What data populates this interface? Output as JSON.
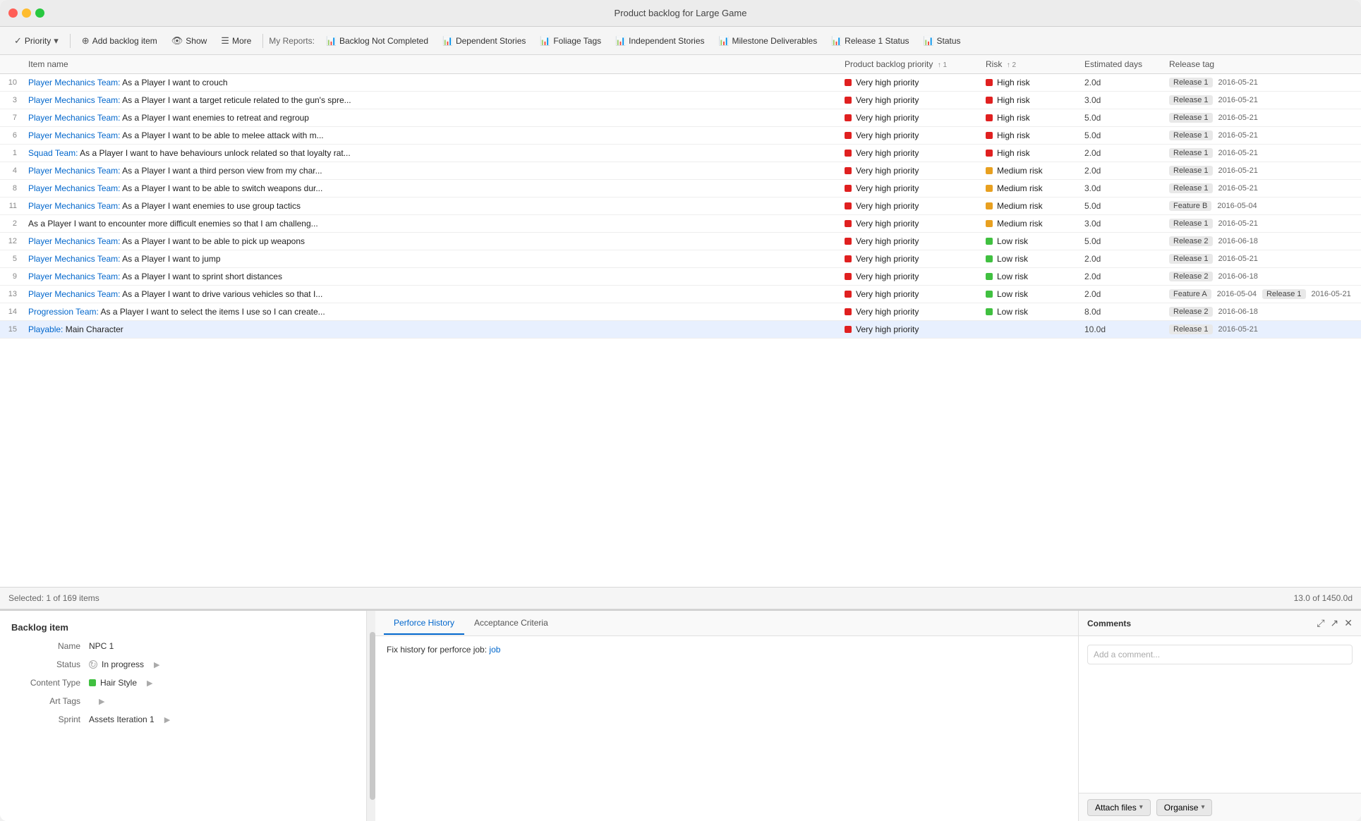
{
  "app": {
    "title": "Product backlog for Large Game",
    "traffic_lights": [
      "red",
      "yellow",
      "green"
    ]
  },
  "toolbar": {
    "priority_label": "Priority",
    "add_backlog_label": "Add backlog item",
    "show_label": "Show",
    "more_label": "More",
    "reports_label": "My Reports:",
    "reports": [
      {
        "label": "Backlog Not Completed"
      },
      {
        "label": "Dependent Stories"
      },
      {
        "label": "Foliage Tags"
      },
      {
        "label": "Independent Stories"
      },
      {
        "label": "Milestone Deliverables"
      },
      {
        "label": "Release 1 Status"
      },
      {
        "label": "Status"
      }
    ]
  },
  "table": {
    "columns": [
      {
        "key": "num",
        "label": ""
      },
      {
        "key": "name",
        "label": "Item name"
      },
      {
        "key": "priority",
        "label": "Product backlog priority",
        "sort": "1"
      },
      {
        "key": "risk",
        "label": "Risk",
        "sort": "2"
      },
      {
        "key": "estimated",
        "label": "Estimated days"
      },
      {
        "key": "release",
        "label": "Release tag"
      }
    ],
    "rows": [
      {
        "num": "10",
        "name": "Player Mechanics Team: As a Player I want to crouch",
        "priority": "Very high priority",
        "priority_color": "red",
        "risk": "High risk",
        "risk_color": "red",
        "estimated": "2.0d",
        "release": "Release 1",
        "release_date": "2016-05-21"
      },
      {
        "num": "3",
        "name": "Player Mechanics Team: As a Player I want a target reticule related to the gun's spre...",
        "priority": "Very high priority",
        "priority_color": "red",
        "risk": "High risk",
        "risk_color": "red",
        "estimated": "3.0d",
        "release": "Release 1",
        "release_date": "2016-05-21"
      },
      {
        "num": "7",
        "name": "Player Mechanics Team: As a Player I want enemies to retreat and regroup",
        "priority": "Very high priority",
        "priority_color": "red",
        "risk": "High risk",
        "risk_color": "red",
        "estimated": "5.0d",
        "release": "Release 1",
        "release_date": "2016-05-21"
      },
      {
        "num": "6",
        "name": "Player Mechanics Team: As a Player I want to be able to melee attack with m...",
        "priority": "Very high priority",
        "priority_color": "red",
        "risk": "High risk",
        "risk_color": "red",
        "estimated": "5.0d",
        "release": "Release 1",
        "release_date": "2016-05-21"
      },
      {
        "num": "1",
        "name": "Squad Team: As a Player I want to have behaviours unlock related so that loyalty rat...",
        "priority": "Very high priority",
        "priority_color": "red",
        "risk": "High risk",
        "risk_color": "red",
        "estimated": "2.0d",
        "release": "Release 1",
        "release_date": "2016-05-21"
      },
      {
        "num": "4",
        "name": "Player Mechanics Team: As a Player I want a third person view from my char...",
        "priority": "Very high priority",
        "priority_color": "red",
        "risk": "Medium risk",
        "risk_color": "yellow",
        "estimated": "2.0d",
        "release": "Release 1",
        "release_date": "2016-05-21"
      },
      {
        "num": "8",
        "name": "Player Mechanics Team: As a Player I want to be able to switch weapons dur...",
        "priority": "Very high priority",
        "priority_color": "red",
        "risk": "Medium risk",
        "risk_color": "yellow",
        "estimated": "3.0d",
        "release": "Release 1",
        "release_date": "2016-05-21"
      },
      {
        "num": "11",
        "name": "Player Mechanics Team: As a Player I want enemies to use group tactics",
        "priority": "Very high priority",
        "priority_color": "red",
        "risk": "Medium risk",
        "risk_color": "yellow",
        "estimated": "5.0d",
        "release": "Feature B",
        "release_date": "2016-05-04"
      },
      {
        "num": "2",
        "name": "As a Player I want to encounter more difficult enemies so that I am challeng...",
        "priority": "Very high priority",
        "priority_color": "red",
        "risk": "Medium risk",
        "risk_color": "yellow",
        "estimated": "3.0d",
        "release": "Release 1",
        "release_date": "2016-05-21"
      },
      {
        "num": "12",
        "name": "Player Mechanics Team: As a Player I want to be able to pick up weapons",
        "priority": "Very high priority",
        "priority_color": "red",
        "risk": "Low risk",
        "risk_color": "green",
        "estimated": "5.0d",
        "release": "Release 2",
        "release_date": "2016-06-18"
      },
      {
        "num": "5",
        "name": "Player Mechanics Team: As a Player I want to jump",
        "priority": "Very high priority",
        "priority_color": "red",
        "risk": "Low risk",
        "risk_color": "green",
        "estimated": "2.0d",
        "release": "Release 1",
        "release_date": "2016-05-21"
      },
      {
        "num": "9",
        "name": "Player Mechanics Team: As a Player I want to sprint short distances",
        "priority": "Very high priority",
        "priority_color": "red",
        "risk": "Low risk",
        "risk_color": "green",
        "estimated": "2.0d",
        "release": "Release 2",
        "release_date": "2016-06-18"
      },
      {
        "num": "13",
        "name": "Player Mechanics Team: As a Player I want to drive various vehicles so that I...",
        "priority": "Very high priority",
        "priority_color": "red",
        "risk": "Low risk",
        "risk_color": "green",
        "estimated": "2.0d",
        "release": "Feature A",
        "release_date": "2016-05-04",
        "release2": "Release 1",
        "release2_date": "2016-05-21"
      },
      {
        "num": "14",
        "name": "Progression Team: As a Player I want to select the items I use so I can create...",
        "priority": "Very high priority",
        "priority_color": "red",
        "risk": "Low risk",
        "risk_color": "green",
        "estimated": "8.0d",
        "release": "Release 2",
        "release_date": "2016-06-18"
      },
      {
        "num": "15",
        "name": "Playable: Main Character",
        "priority": "Very high priority",
        "priority_color": "red",
        "risk": "",
        "risk_color": "",
        "estimated": "10.0d",
        "release": "Release 1",
        "release_date": "2016-05-21"
      }
    ]
  },
  "status_bar": {
    "selected_text": "Selected: 1 of 169 items",
    "total_text": "13.0 of 1450.0d"
  },
  "detail": {
    "title": "Backlog item",
    "fields": [
      {
        "label": "Name",
        "value": "NPC 1",
        "has_arrow": false
      },
      {
        "label": "Status",
        "value": "In progress",
        "has_arrow": true,
        "icon": "progress"
      },
      {
        "label": "Content Type",
        "value": "Hair Style",
        "has_arrow": true,
        "icon": "green-dot"
      },
      {
        "label": "Art Tags",
        "value": "",
        "has_arrow": true
      },
      {
        "label": "Sprint",
        "value": "Assets Iteration 1",
        "has_arrow": true
      }
    ],
    "tabs": [
      {
        "label": "Perforce History",
        "active": true
      },
      {
        "label": "Acceptance Criteria",
        "active": false
      }
    ],
    "tab_content": "Fix history for perforce job:",
    "tab_link": "job",
    "comments_title": "Comments",
    "comment_placeholder": "Add a comment...",
    "attach_label": "Attach files",
    "organise_label": "Organise"
  },
  "footer": {
    "sprint_label": "Assets Iteration",
    "sprint_value": "Assets Iteration 1"
  }
}
